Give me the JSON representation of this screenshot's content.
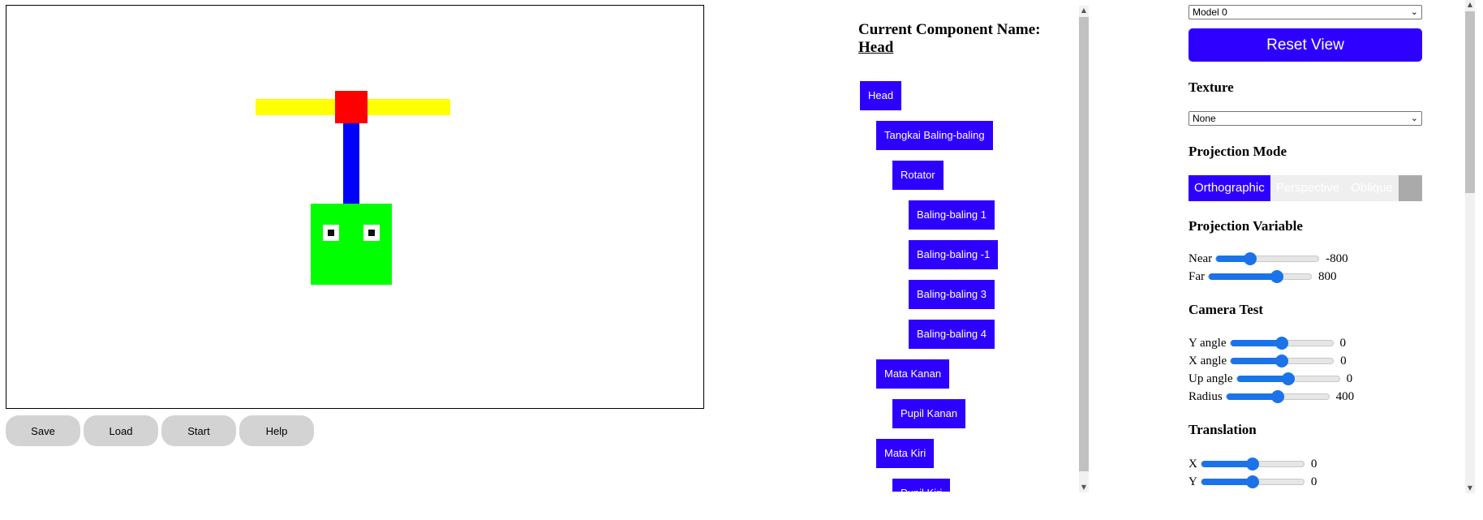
{
  "canvas_colors": {
    "propeller": "#ffff00",
    "hub": "#ff0000",
    "stem": "#0000ff",
    "head": "#00ff00",
    "eye": "#ffffff",
    "pupil": "#111111"
  },
  "buttons": {
    "save": "Save",
    "load": "Load",
    "start": "Start",
    "help": "Help"
  },
  "tree": {
    "title": "Current Component Name:",
    "current_name": "Head",
    "nodes": [
      {
        "label": "Head",
        "depth": 0
      },
      {
        "label": "Tangkai Baling-baling",
        "depth": 1
      },
      {
        "label": "Rotator",
        "depth": 2
      },
      {
        "label": "Baling-baling 1",
        "depth": 3
      },
      {
        "label": "Baling-baling -1",
        "depth": 3
      },
      {
        "label": "Baling-baling 3",
        "depth": 3
      },
      {
        "label": "Baling-baling 4",
        "depth": 3
      },
      {
        "label": "Mata Kanan",
        "depth": 1
      },
      {
        "label": "Pupil Kanan",
        "depth": 2
      },
      {
        "label": "Mata Kiri",
        "depth": 1
      },
      {
        "label": "Pupil Kiri",
        "depth": 2
      }
    ]
  },
  "controls": {
    "model_select": "Model 0",
    "reset_label": "Reset View",
    "texture_heading": "Texture",
    "texture_select": "None",
    "projection_heading": "Projection Mode",
    "projection_modes": [
      "Orthographic",
      "Perspective",
      "Oblique"
    ],
    "projection_active": "Orthographic",
    "projection_var_heading": "Projection Variable",
    "near": {
      "label": "Near",
      "value": "-800",
      "fraction": 0.33
    },
    "far": {
      "label": "Far",
      "value": "800",
      "fraction": 0.67
    },
    "camera_heading": "Camera Test",
    "y_angle": {
      "label": "Y angle",
      "value": "0",
      "fraction": 0.5
    },
    "x_angle": {
      "label": "X angle",
      "value": "0",
      "fraction": 0.5
    },
    "up_angle": {
      "label": "Up angle",
      "value": "0",
      "fraction": 0.5
    },
    "radius": {
      "label": "Radius",
      "value": "400",
      "fraction": 0.5
    },
    "translation_heading": "Translation",
    "tx": {
      "label": "X",
      "value": "0",
      "fraction": 0.5
    },
    "ty": {
      "label": "Y",
      "value": "0",
      "fraction": 0.5
    }
  }
}
